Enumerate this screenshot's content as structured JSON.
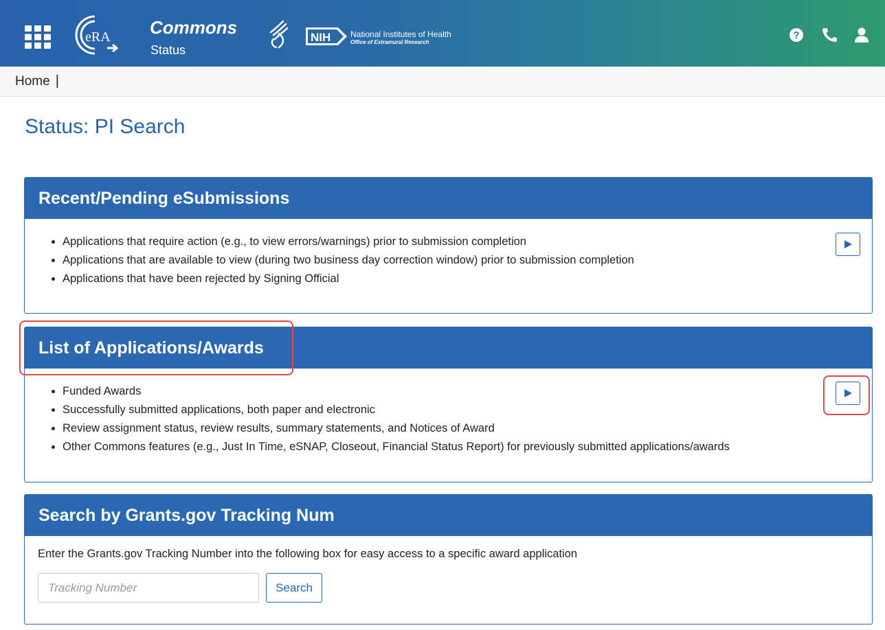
{
  "header": {
    "app_name": "Commons",
    "app_sub": "Status",
    "nih_badge": "NIH",
    "nih_name": "National Institutes of Health",
    "nih_office": "Office of Extramural Research",
    "icons": [
      "apps-grid-icon",
      "era-logo",
      "hhs-logo",
      "nih-logo",
      "help-icon",
      "phone-icon",
      "user-icon"
    ]
  },
  "breadcrumb": {
    "home": "Home",
    "separator": "|"
  },
  "page": {
    "title": "Status: PI Search"
  },
  "panels": [
    {
      "title": "Recent/Pending eSubmissions",
      "items": [
        "Applications that require action (e.g., to view errors/warnings) prior to submission completion",
        "Applications that are available to view (during two business day correction window) prior to submission completion",
        "Applications that have been rejected by Signing Official"
      ]
    },
    {
      "title": "List of Applications/Awards",
      "items": [
        "Funded Awards",
        "Successfully submitted applications, both paper and electronic",
        "Review assignment status, review results, summary statements, and Notices of Award",
        "Other Commons features (e.g., Just In Time, eSNAP, Closeout, Financial Status Report) for previously submitted applications/awards"
      ]
    }
  ],
  "search": {
    "title": "Search by Grants.gov Tracking Num",
    "description": "Enter the Grants.gov Tracking Number into the following box for easy access to a specific award application",
    "placeholder": "Tracking Number",
    "button_label": "Search"
  },
  "colors": {
    "primary": "#2c67b1",
    "title": "#2a63a8",
    "highlight": "#e04848",
    "header_gradient_start": "#2961ad",
    "header_gradient_end": "#2e9a6e"
  }
}
